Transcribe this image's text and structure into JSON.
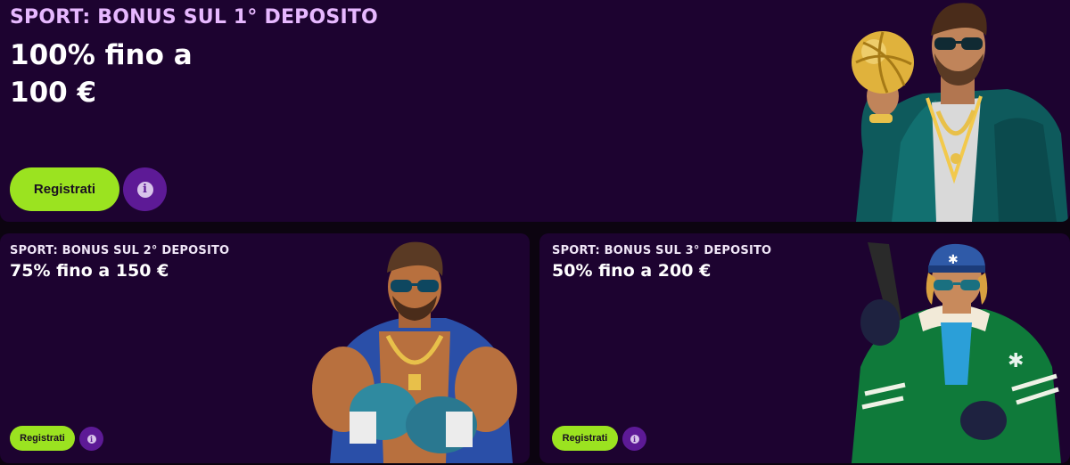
{
  "promos": {
    "main": {
      "kicker": "SPORT: BONUS SUL 1° DEPOSITO",
      "headline_line1": "100% fino a",
      "headline_line2": "100 €",
      "button_label": "Registrati",
      "info_glyph": "i",
      "illustration": "footballer-with-golden-ball"
    },
    "second": {
      "kicker": "SPORT: BONUS SUL 2° DEPOSITO",
      "headline": "75% fino a 150 €",
      "button_label": "Registrati",
      "info_glyph": "i",
      "illustration": "boxer-with-gloves"
    },
    "third": {
      "kicker": "SPORT: BONUS SUL 3° DEPOSITO",
      "headline": "50% fino a 200 €",
      "button_label": "Registrati",
      "info_glyph": "i",
      "illustration": "hockey-player-with-stick"
    }
  },
  "colors": {
    "card_bg": "#1d0330",
    "page_bg": "#0c0410",
    "kicker": "#e7b8ff",
    "cta": "#9be320",
    "info": "#5d1a96"
  }
}
